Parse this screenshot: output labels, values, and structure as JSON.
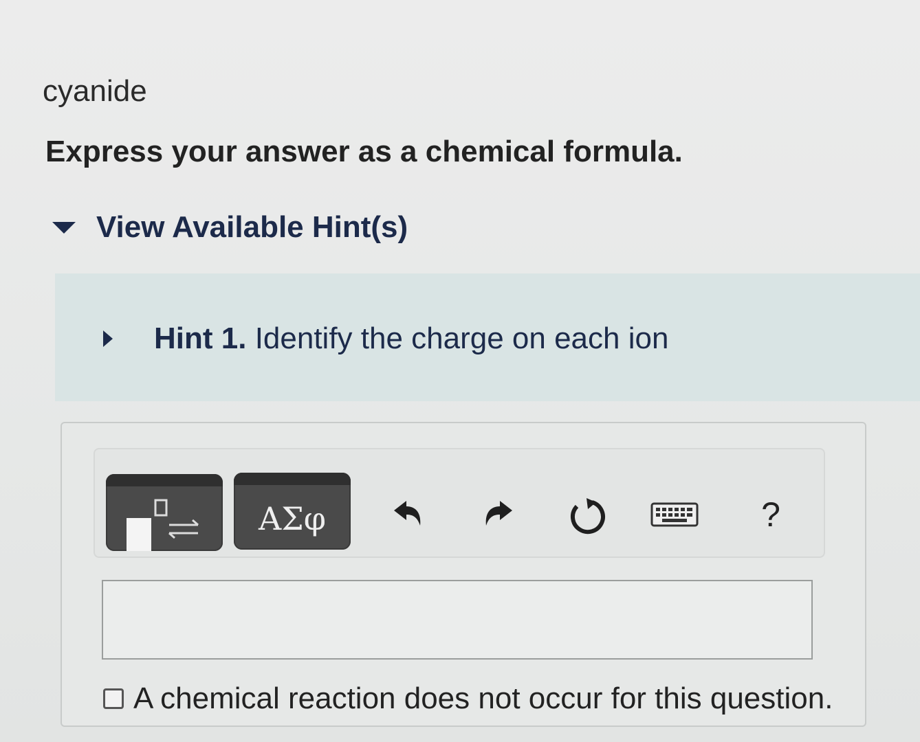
{
  "question": {
    "compound_name": "cyanide",
    "instruction": "Express your answer as a chemical formula."
  },
  "hints": {
    "toggle_label": "View Available Hint(s)",
    "items": [
      {
        "label": "Hint 1.",
        "text": "Identify the charge on each ion"
      }
    ]
  },
  "toolbar": {
    "templates_icon": "templates-icon",
    "symbols_label": "ΑΣφ",
    "undo_icon": "undo-icon",
    "redo_icon": "redo-icon",
    "reset_icon": "reset-icon",
    "keyboard_icon": "keyboard-icon",
    "help_label": "?"
  },
  "answer": {
    "value": "",
    "no_reaction_label": "A chemical reaction does not occur for this question.",
    "no_reaction_checked": false
  },
  "colors": {
    "hint_text": "#1c2a4a",
    "hint_panel": "#d9e4e4",
    "toolbar_button": "#4a4a4a"
  }
}
